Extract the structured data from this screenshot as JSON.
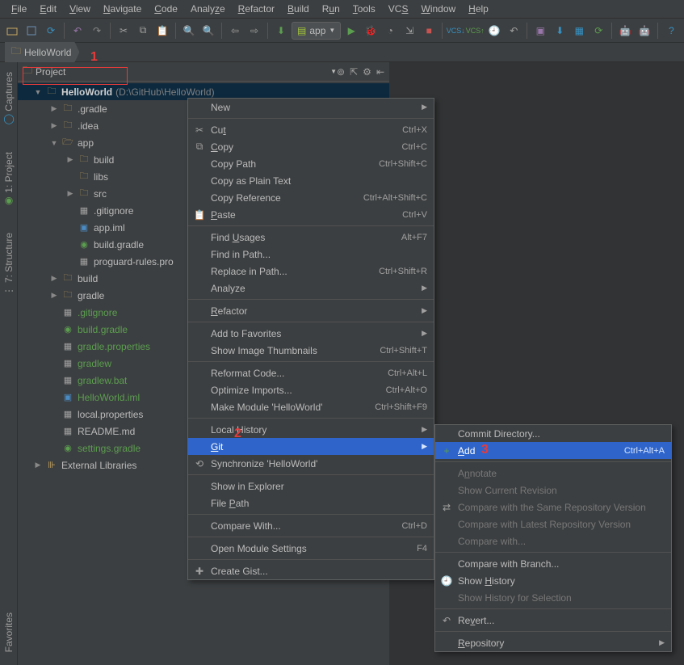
{
  "menubar": [
    "File",
    "Edit",
    "View",
    "Navigate",
    "Code",
    "Analyze",
    "Refactor",
    "Build",
    "Run",
    "Tools",
    "VCS",
    "Window",
    "Help"
  ],
  "runconfig": {
    "icon": "android",
    "label": "app"
  },
  "breadcrumb": {
    "project": "HelloWorld"
  },
  "panel": {
    "title": "Project"
  },
  "sidebar_tabs": [
    "Captures",
    "1: Project",
    "7: Structure",
    "Favorites"
  ],
  "tree": {
    "root": {
      "name": "HelloWorld",
      "path": "(D:\\GitHub\\HelloWorld)"
    },
    "gradle_dir": ".gradle",
    "idea_dir": ".idea",
    "app_dir": "app",
    "app_build": "build",
    "app_libs": "libs",
    "app_src": "src",
    "app_gitignore": ".gitignore",
    "app_iml": "app.iml",
    "app_buildgradle": "build.gradle",
    "app_proguard": "proguard-rules.pro",
    "build_dir": "build",
    "gradle_dir2": "gradle",
    "gitignore": ".gitignore",
    "buildgradle": "build.gradle",
    "gradleprops": "gradle.properties",
    "gradlew": "gradlew",
    "gradlewbat": "gradlew.bat",
    "hworld_iml": "HelloWorld.iml",
    "localprops": "local.properties",
    "readme": "README.md",
    "settingsgradle": "settings.gradle",
    "ext": "External Libraries"
  },
  "ctx1": [
    {
      "label": "New",
      "sub": true
    },
    {
      "sep": true
    },
    {
      "icon": "✂",
      "label": "Cut",
      "sc": "Ctrl+X"
    },
    {
      "icon": "⧉",
      "label": "Copy",
      "sc": "Ctrl+C"
    },
    {
      "label": "Copy Path",
      "sc": "Ctrl+Shift+C"
    },
    {
      "label": "Copy as Plain Text"
    },
    {
      "label": "Copy Reference",
      "sc": "Ctrl+Alt+Shift+C"
    },
    {
      "icon": "📋",
      "label": "Paste",
      "sc": "Ctrl+V"
    },
    {
      "sep": true
    },
    {
      "label": "Find Usages",
      "sc": "Alt+F7"
    },
    {
      "label": "Find in Path..."
    },
    {
      "label": "Replace in Path...",
      "sc": "Ctrl+Shift+R"
    },
    {
      "label": "Analyze",
      "sub": true
    },
    {
      "sep": true
    },
    {
      "label": "Refactor",
      "sub": true
    },
    {
      "sep": true
    },
    {
      "label": "Add to Favorites",
      "sub": true
    },
    {
      "label": "Show Image Thumbnails",
      "sc": "Ctrl+Shift+T"
    },
    {
      "sep": true
    },
    {
      "label": "Reformat Code...",
      "sc": "Ctrl+Alt+L"
    },
    {
      "label": "Optimize Imports...",
      "sc": "Ctrl+Alt+O"
    },
    {
      "label": "Make Module 'HelloWorld'",
      "sc": "Ctrl+Shift+F9"
    },
    {
      "sep": true
    },
    {
      "label": "Local History",
      "sub": true
    },
    {
      "label": "Git",
      "sub": true,
      "hl": true
    },
    {
      "icon": "⟲",
      "label": "Synchronize 'HelloWorld'"
    },
    {
      "sep": true
    },
    {
      "label": "Show in Explorer"
    },
    {
      "label": "File Path"
    },
    {
      "sep": true
    },
    {
      "label": "Compare With...",
      "sc": "Ctrl+D"
    },
    {
      "sep": true
    },
    {
      "label": "Open Module Settings",
      "sc": "F4"
    },
    {
      "sep": true
    },
    {
      "icon": "✚",
      "label": "Create Gist..."
    }
  ],
  "ctx2": [
    {
      "label": "Commit Directory..."
    },
    {
      "icon": "+",
      "iconcolor": "#5b9e4f",
      "label": "Add",
      "sc": "Ctrl+Alt+A",
      "hl": true
    },
    {
      "sep": true
    },
    {
      "label": "Annotate",
      "disabled": true
    },
    {
      "label": "Show Current Revision",
      "disabled": true
    },
    {
      "icon": "⇄",
      "label": "Compare with the Same Repository Version",
      "disabled": true
    },
    {
      "label": "Compare with Latest Repository Version",
      "disabled": true
    },
    {
      "label": "Compare with...",
      "disabled": true
    },
    {
      "sep": true
    },
    {
      "label": "Compare with Branch..."
    },
    {
      "icon": "🕘",
      "label": "Show History"
    },
    {
      "label": "Show History for Selection",
      "disabled": true
    },
    {
      "sep": true
    },
    {
      "icon": "↶",
      "label": "Revert..."
    },
    {
      "sep": true
    },
    {
      "label": "Repository",
      "sub": true
    }
  ],
  "annot": {
    "a1": "1",
    "a2": "2",
    "a3": "3"
  }
}
